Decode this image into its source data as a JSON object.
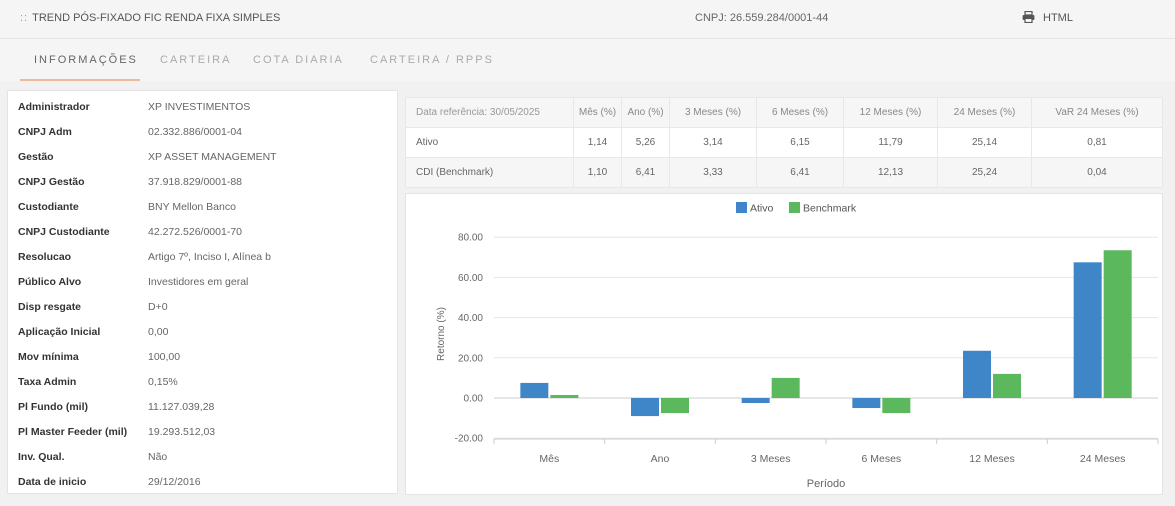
{
  "header": {
    "grip": "::",
    "title": "TREND PÓS-FIXADO FIC RENDA FIXA SIMPLES",
    "cnpj": "CNPJ: 26.559.284/0001-44",
    "html_label": "HTML"
  },
  "tabs": [
    {
      "label": "INFORMAÇÕES"
    },
    {
      "label": "CARTEIRA"
    },
    {
      "label": "COTA DIARIA"
    },
    {
      "label": "CARTEIRA / RPPS"
    }
  ],
  "info": [
    {
      "key": "Administrador",
      "value": "XP INVESTIMENTOS"
    },
    {
      "key": "CNPJ Adm",
      "value": "02.332.886/0001-04"
    },
    {
      "key": "Gestão",
      "value": "XP ASSET MANAGEMENT"
    },
    {
      "key": "CNPJ Gestão",
      "value": "37.918.829/0001-88"
    },
    {
      "key": "Custodiante",
      "value": "BNY Mellon Banco"
    },
    {
      "key": "CNPJ Custodiante",
      "value": "42.272.526/0001-70"
    },
    {
      "key": "Resolucao",
      "value": "Artigo 7º, Inciso I, Alínea b"
    },
    {
      "key": "Público Alvo",
      "value": "Investidores em geral"
    },
    {
      "key": "Disp resgate",
      "value": "D+0"
    },
    {
      "key": "Aplicação Inicial",
      "value": "0,00"
    },
    {
      "key": "Mov mínima",
      "value": "100,00"
    },
    {
      "key": "Taxa Admin",
      "value": "0,15%"
    },
    {
      "key": "Pl Fundo (mil)",
      "value": "11.127.039,28"
    },
    {
      "key": "Pl Master Feeder (mil)",
      "value": "19.293.512,03"
    },
    {
      "key": "Inv. Qual.",
      "value": "Não"
    },
    {
      "key": "Data de inicio",
      "value": "29/12/2016"
    }
  ],
  "returns_table": {
    "headers": [
      "Data referência: 30/05/2025",
      "Mês (%)",
      "Ano (%)",
      "3 Meses (%)",
      "6 Meses (%)",
      "12 Meses (%)",
      "24 Meses (%)",
      "VaR 24 Meses (%)"
    ],
    "rows": [
      [
        "Ativo",
        "1,14",
        "5,26",
        "3,14",
        "6,15",
        "11,79",
        "25,14",
        "0,81"
      ],
      [
        "CDI (Benchmark)",
        "1,10",
        "6,41",
        "3,33",
        "6,41",
        "12,13",
        "25,24",
        "0,04"
      ]
    ]
  },
  "chart_data": {
    "type": "bar",
    "categories": [
      "Mês",
      "Ano",
      "3 Meses",
      "6 Meses",
      "12 Meses",
      "24 Meses"
    ],
    "series": [
      {
        "name": "Ativo",
        "color": "#3f86c9",
        "values": [
          7.5,
          -9,
          -2.5,
          -5,
          23.5,
          67.5
        ]
      },
      {
        "name": "Benchmark",
        "color": "#5cb85c",
        "values": [
          1.5,
          -7.5,
          10,
          -7.5,
          12,
          73.5
        ]
      }
    ],
    "xlabel": "Período",
    "ylabel": "Retorno (%)",
    "ylim": [
      -20,
      80
    ],
    "yticks": [
      "80.00",
      "60.00",
      "40.00",
      "20.00",
      "0.00",
      "-20.00"
    ],
    "ytick_values": [
      80,
      60,
      40,
      20,
      0,
      -20
    ],
    "legend_position": "top-center",
    "grid": true
  }
}
